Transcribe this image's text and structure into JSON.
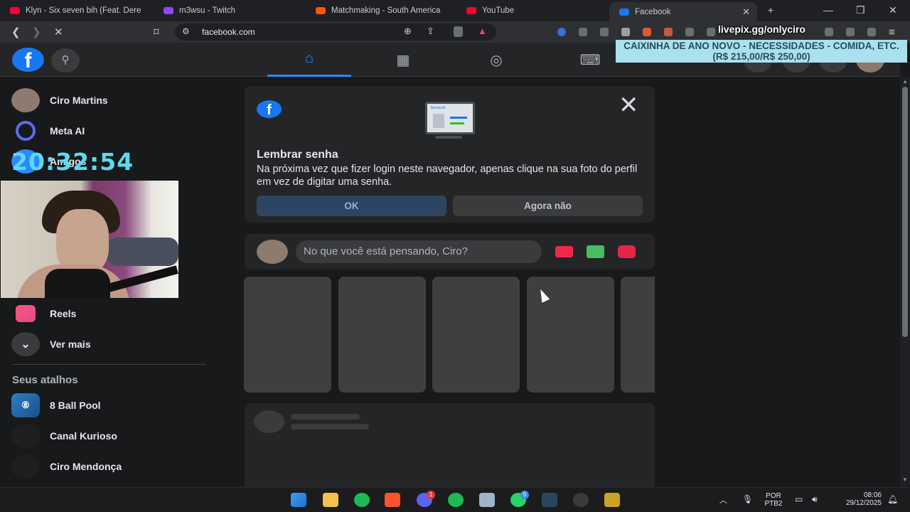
{
  "browser": {
    "tabs": [
      {
        "title": "Klyn - Six seven bih (Feat. Dere",
        "icon": "youtube-icon",
        "color": "#ff0033"
      },
      {
        "title": "m3wsu - Twitch",
        "icon": "twitch-icon",
        "color": "#9146ff"
      },
      {
        "title": "Matchmaking - South America",
        "icon": "faceit-icon",
        "color": "#ff5500"
      },
      {
        "title": "YouTube",
        "icon": "youtube-icon",
        "color": "#ff0033"
      },
      {
        "title": "Facebook",
        "icon": "facebook-icon",
        "color": "#1877f2",
        "active": true
      }
    ],
    "new_tab": "+",
    "url": "facebook.com"
  },
  "overlay": {
    "url": "livepix.gg/onlyciro",
    "banner_line1": "CAIXINHA DE ANO NOVO - NECESSIDADES - COMIDA, ETC.",
    "banner_line2": "(R$ 215,00/R$ 250,00)",
    "clock": "20:32:54"
  },
  "sidebar": {
    "items_top": [
      {
        "label": "Ciro Martins",
        "icon": "avatar"
      },
      {
        "label": "Meta AI",
        "icon": "meta-ai-icon"
      },
      {
        "label": "Amigos",
        "icon": "friends-icon"
      }
    ],
    "items_bottom": [
      {
        "label": "Reels",
        "icon": "reels-icon"
      },
      {
        "label": "Ver mais",
        "icon": "chevron-down-icon"
      }
    ],
    "shortcuts_title": "Seus atalhos",
    "shortcuts": [
      {
        "label": "8 Ball Pool"
      },
      {
        "label": "Canal Kurioso"
      },
      {
        "label": "Ciro Mendonça"
      }
    ]
  },
  "password_prompt": {
    "title": "Lembrar senha",
    "text": "Na próxima vez que fizer login neste navegador, apenas clique na sua foto do perfil em vez de digitar uma senha.",
    "ok_label": "OK",
    "not_now_label": "Agora não",
    "illustration_label": "facebook"
  },
  "composer": {
    "placeholder": "No que você está pensando, Ciro?"
  },
  "taskbar": {
    "lang_top": "POR",
    "lang_bottom": "PTB2",
    "time": "08:06",
    "date": "29/12/2025",
    "discord_badge": "1",
    "whatsapp_badge": "5"
  }
}
